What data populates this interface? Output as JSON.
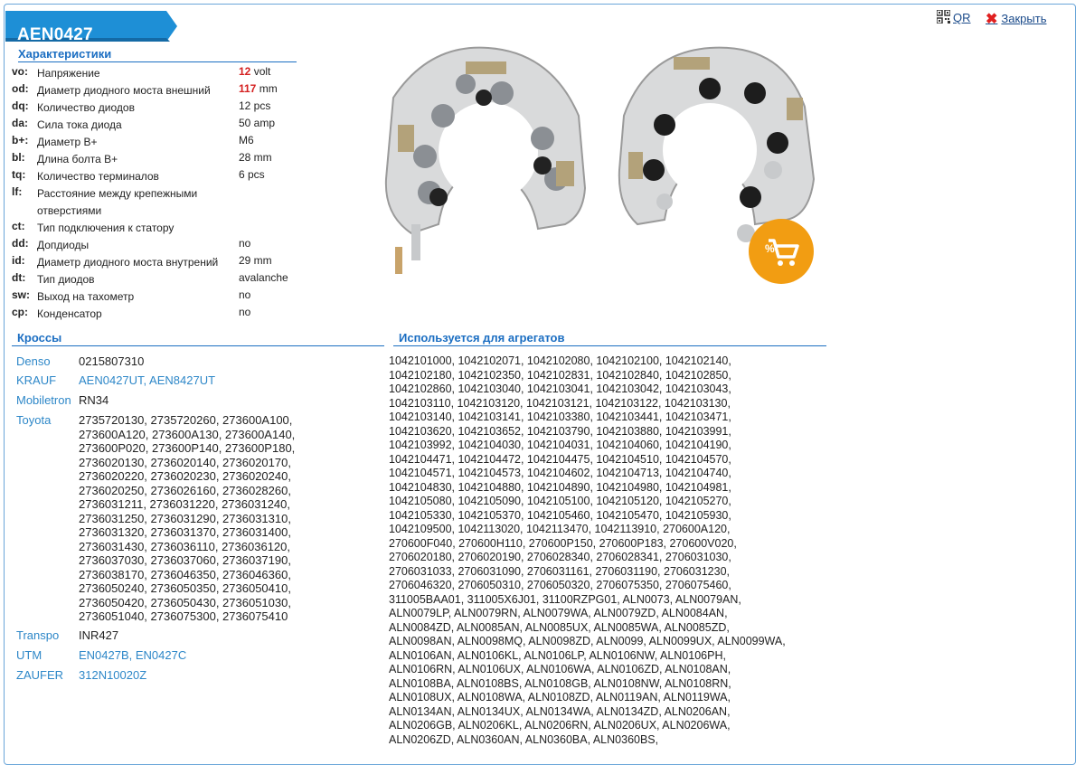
{
  "title": "AEN0427",
  "links": {
    "qr": "QR",
    "close": "Закрыть"
  },
  "specs_title": "Характеристики",
  "specs": [
    {
      "code": "vo:",
      "name": "Напряжение",
      "value": "12",
      "unit": " volt",
      "highlight": true
    },
    {
      "code": "od:",
      "name": "Диаметр диодного моста внешний",
      "value": "117",
      "unit": " mm",
      "highlight": true
    },
    {
      "code": "dq:",
      "name": "Количество диодов",
      "value": "12 pcs"
    },
    {
      "code": "da:",
      "name": "Сила тока диода",
      "value": "50 amp"
    },
    {
      "code": "b+:",
      "name": "Диаметр B+",
      "value": "M6"
    },
    {
      "code": "bl:",
      "name": "Длина болта B+",
      "value": "28 mm"
    },
    {
      "code": "tq:",
      "name": "Количество терминалов",
      "value": "6 pcs"
    },
    {
      "code": "lf:",
      "name": "Расстояние между крепежными отверстиями",
      "value": ""
    },
    {
      "code": "ct:",
      "name": "Тип подключения к статору",
      "value": ""
    },
    {
      "code": "dd:",
      "name": "Допдиоды",
      "value": "no"
    },
    {
      "code": "id:",
      "name": "Диаметр диодного моста внутрений",
      "value": "29 mm"
    },
    {
      "code": "dt:",
      "name": "Тип диодов",
      "value": "avalanche"
    },
    {
      "code": "sw:",
      "name": "Выход на тахометр",
      "value": "no"
    },
    {
      "code": "cp:",
      "name": "Конденсатор",
      "value": "no"
    }
  ],
  "crosses_title": "Кроссы",
  "crosses": [
    {
      "brand": "Denso",
      "values": "0215807310",
      "link": false
    },
    {
      "brand": "KRAUF",
      "values": "AEN0427UT, AEN8427UT",
      "link": true
    },
    {
      "brand": "Mobiletron",
      "values": "RN34",
      "link": false
    },
    {
      "brand": "Toyota",
      "values": "2735720130, 2735720260, 273600A100, 273600A120, 273600A130, 273600A140, 273600P020, 273600P140, 273600P180, 2736020130, 2736020140, 2736020170, 2736020220, 2736020230, 2736020240, 2736020250, 2736026160, 2736028260, 2736031211, 2736031220, 2736031240, 2736031250, 2736031290, 2736031310, 2736031320, 2736031370, 2736031400, 2736031430, 2736036110, 2736036120, 2736037030, 2736037060, 2736037190, 2736038170, 2736046350, 2736046360, 2736050240, 2736050350, 2736050410, 2736050420, 2736050430, 2736051030, 2736051040, 2736075300, 2736075410",
      "link": false
    },
    {
      "brand": "Transpo",
      "values": "INR427",
      "link": false
    },
    {
      "brand": "UTM",
      "values": "EN0427B, EN0427C",
      "link": true
    },
    {
      "brand": "ZAUFER",
      "values": "312N10020Z",
      "link": true
    }
  ],
  "apps_title": "Используется для агрегатов",
  "apps_text": "1042101000, 1042102071, 1042102080, 1042102100, 1042102140, 1042102180, 1042102350, 1042102831, 1042102840, 1042102850, 1042102860, 1042103040, 1042103041, 1042103042, 1042103043, 1042103110, 1042103120, 1042103121, 1042103122, 1042103130, 1042103140, 1042103141, 1042103380, 1042103441, 1042103471, 1042103620, 1042103652, 1042103790, 1042103880, 1042103991, 1042103992, 1042104030, 1042104031, 1042104060, 1042104190, 1042104471, 1042104472, 1042104475, 1042104510, 1042104570, 1042104571, 1042104573, 1042104602, 1042104713, 1042104740, 1042104830, 1042104880, 1042104890, 1042104980, 1042104981, 1042105080, 1042105090, 1042105100, 1042105120, 1042105270, 1042105330, 1042105370, 1042105460, 1042105470, 1042105930, 1042109500, 1042113020, 1042113470, 1042113910, 270600A120, 270600F040, 270600H110, 270600P150, 270600P183, 270600V020, 2706020180, 2706020190, 2706028340, 2706028341, 2706031030, 2706031033, 2706031090, 2706031161, 2706031190, 2706031230, 2706046320, 2706050310, 2706050320, 2706075350, 2706075460, 311005BAA01, 311005X6J01, 31100RZPG01, ALN0073, ALN0079AN, ALN0079LP, ALN0079RN, ALN0079WA, ALN0079ZD, ALN0084AN, ALN0084ZD, ALN0085AN, ALN0085UX, ALN0085WA, ALN0085ZD, ALN0098AN, ALN0098MQ, ALN0098ZD, ALN0099, ALN0099UX, ALN0099WA, ALN0106AN, ALN0106KL, ALN0106LP, ALN0106NW, ALN0106PH, ALN0106RN, ALN0106UX, ALN0106WA, ALN0106ZD, ALN0108AN, ALN0108BA, ALN0108BS, ALN0108GB, ALN0108NW, ALN0108RN, ALN0108UX, ALN0108WA, ALN0108ZD, ALN0119AN, ALN0119WA, ALN0134AN, ALN0134UX, ALN0134WA, ALN0134ZD, ALN0206AN, ALN0206GB, ALN0206KL, ALN0206RN, ALN0206UX, ALN0206WA, ALN0206ZD, ALN0360AN, ALN0360BA, ALN0360BS,",
  "colors": {
    "accent": "#1b6ec2",
    "tab": "#1e8fd6",
    "highlight": "#d42020",
    "cart": "#f29d12"
  },
  "icons": {
    "qr": "qr-code-icon",
    "close": "close-icon",
    "cart": "add-to-cart-icon"
  }
}
